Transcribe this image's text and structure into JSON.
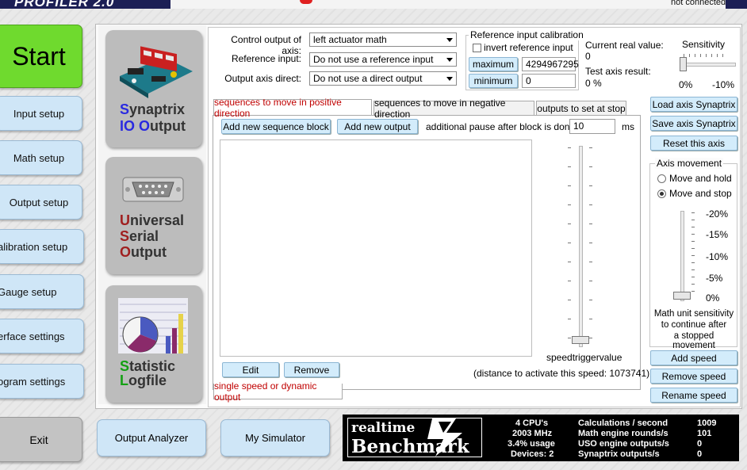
{
  "header": {
    "app_logo": "PROFILER 2.0",
    "status": "not connected"
  },
  "nav": {
    "start": "Start",
    "items": [
      "Input setup",
      "Math setup",
      "Output setup",
      "alibration setup",
      "Gauge setup",
      "erface settings",
      "ogram settings"
    ],
    "exit": "Exit"
  },
  "bottom_buttons": {
    "output_analyzer": "Output Analyzer",
    "my_simulator": "My Simulator"
  },
  "modules": [
    {
      "line1_first": "S",
      "line1_rest": "ynaptrix",
      "line2_first": "IO O",
      "line2_rest": "utput"
    },
    {
      "line1_first": "U",
      "line1_rest": "niversal",
      "line2_first": "S",
      "line2_rest": "erial",
      "line3_first": "O",
      "line3_rest": "utput"
    },
    {
      "line1_first": "S",
      "line1_rest": "tatistic",
      "line2_first": "L",
      "line2_rest": "ogfile"
    }
  ],
  "axis": {
    "control_label": "Control output of axis:",
    "control_value": "left actuator math",
    "reference_label": "Reference input:",
    "reference_value": "Do not use a reference input",
    "direct_label": "Output axis direct:",
    "direct_value": "Do not use a direct output"
  },
  "calibration": {
    "title": "Reference input calibration",
    "invert_label": "invert reference input",
    "maximum_label": "maximum",
    "maximum_value": "4294967295",
    "minimum_label": "minimum",
    "minimum_value": "0"
  },
  "readout": {
    "current_label": "Current real value:",
    "current_value": "0",
    "test_label": "Test axis result:",
    "test_value": "0 %"
  },
  "sensitivity": {
    "label": "Sensitivity",
    "min": "0%",
    "max": "-10%",
    "level": 0
  },
  "tabs": [
    "sequences to move in positive direction",
    "sequences to move in negative direction",
    "outputs to set at stop"
  ],
  "sequence": {
    "add_block": "Add new sequence block",
    "add_output": "Add new output",
    "pause_label": "additional pause after block is done:",
    "pause_value": "10",
    "pause_unit": "ms",
    "edit": "Edit",
    "remove": "Remove",
    "speed_label": "speedtriggervalue",
    "distance_text": "(distance to activate this speed: 1073741)",
    "speed_level": 0,
    "mode_tab": "single speed or dynamic output"
  },
  "right": {
    "load": "Load axis Synaptrix",
    "save": "Save axis Synaptrix",
    "reset": "Reset this axis",
    "movement_title": "Axis movement",
    "move_hold": "Move and hold",
    "move_stop": "Move and stop",
    "selected": "move_stop",
    "scale": [
      "-20%",
      "-15%",
      "-10%",
      "-5%",
      "0%"
    ],
    "math_note_1": "Math unit sensitivity",
    "math_note_2": "to continue after",
    "math_note_3": "a stopped movement",
    "add_speed": "Add speed",
    "remove_speed": "Remove speed",
    "rename_speed": "Rename speed"
  },
  "benchmark": {
    "logo_line1": "realtime",
    "logo_line2": "Benchmark",
    "cpus": "4 CPU's",
    "mhz": "2003 MHz",
    "usage": "3.4% usage",
    "devices": "Devices: 2",
    "labels": [
      "Calculations / second",
      "Math engine rounds/s",
      "USO engine outputs/s",
      "Synaptrix outputs/s"
    ],
    "values": [
      "1009",
      "101",
      "0",
      "0"
    ]
  }
}
